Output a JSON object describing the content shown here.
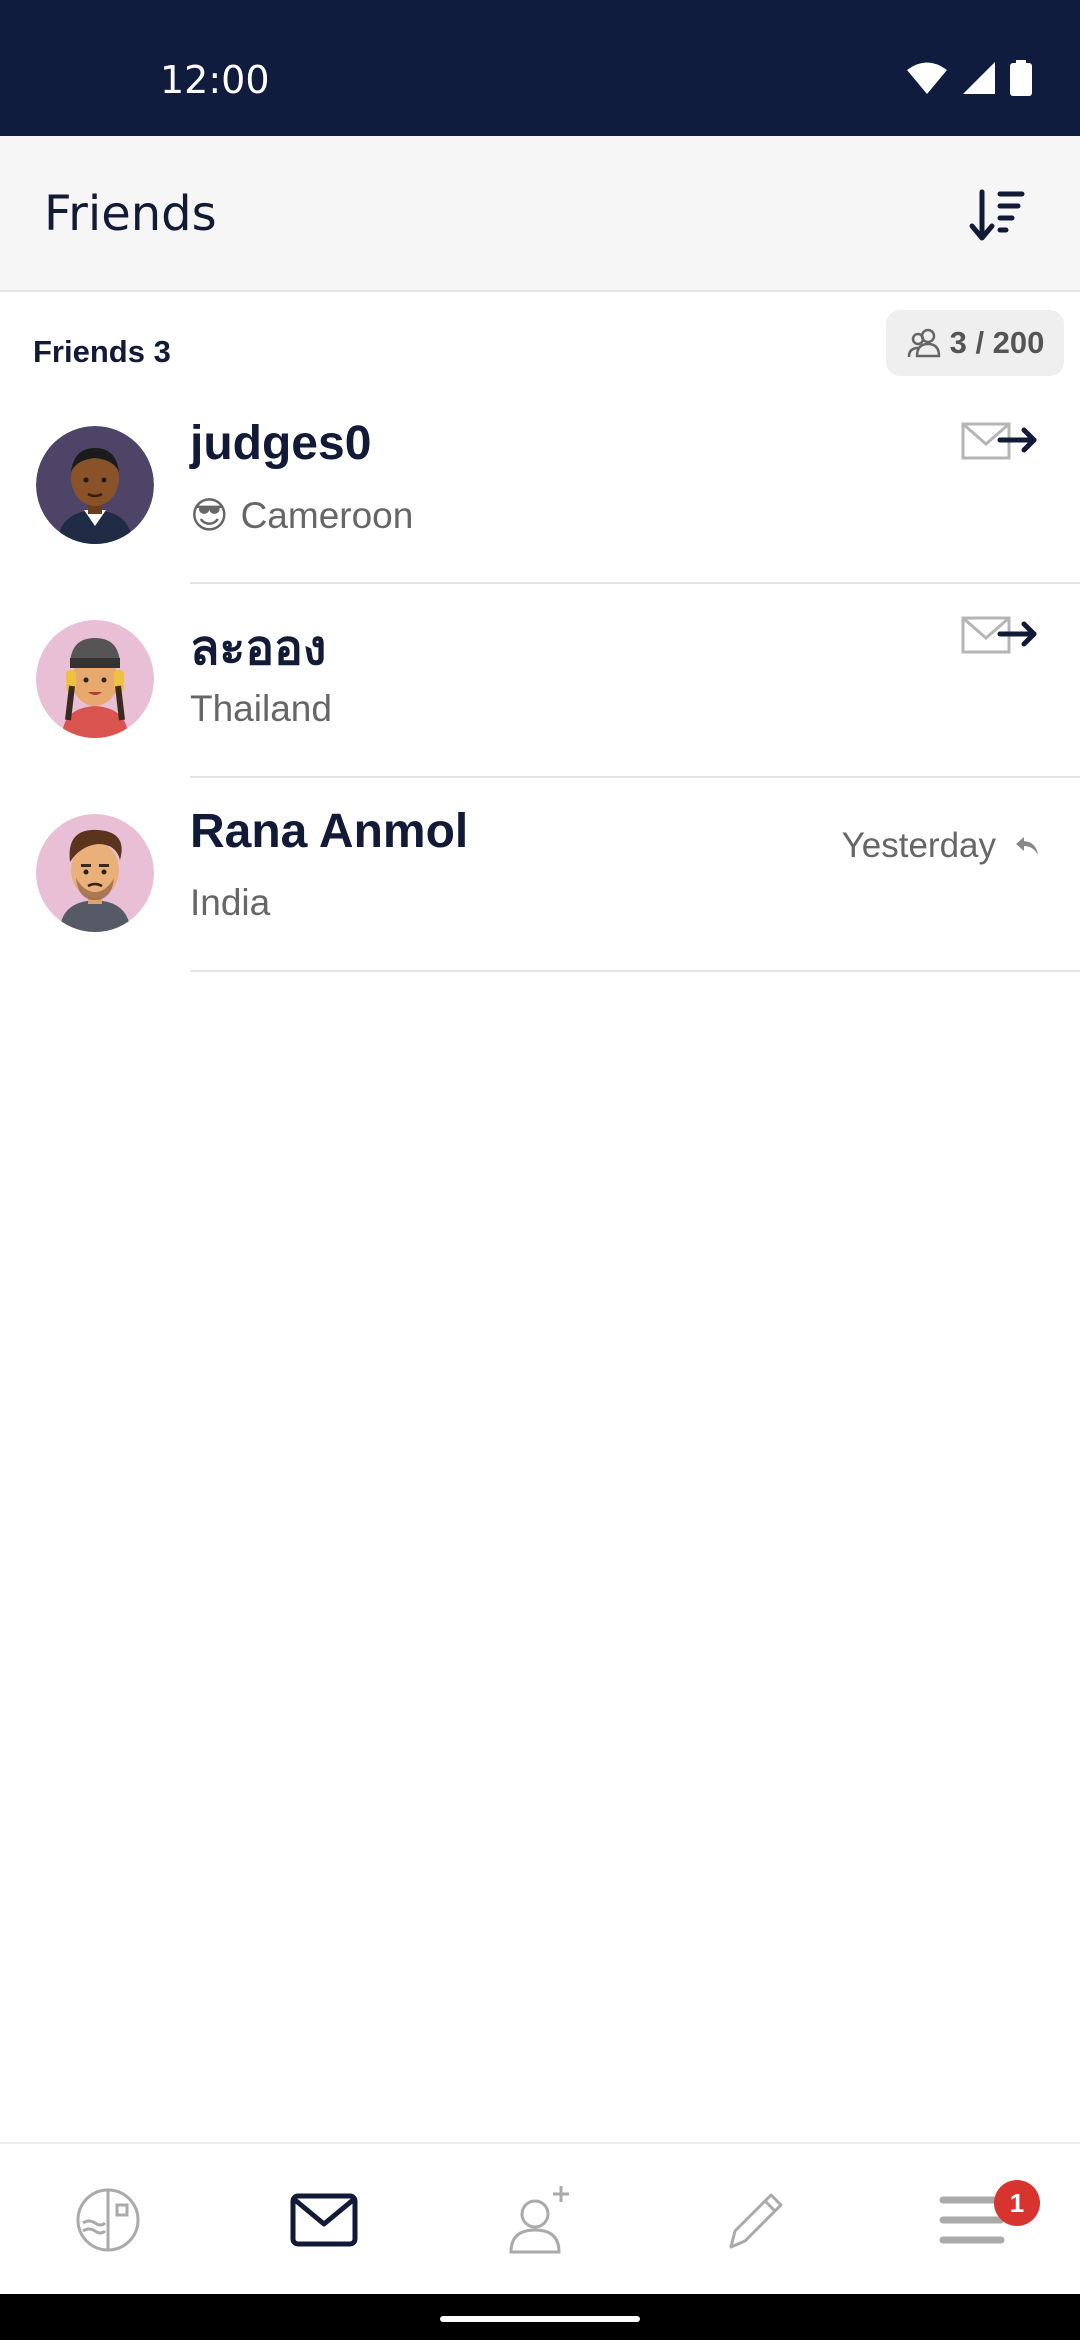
{
  "status_bar": {
    "time": "12:00"
  },
  "app_bar": {
    "title": "Friends",
    "sort_icon": "sort-descending-icon"
  },
  "section": {
    "label": "Friends 3",
    "count_badge": "3 / 200",
    "count_icon": "people-icon"
  },
  "friends": [
    {
      "name": "judges0",
      "country": "Cameroon",
      "emoji": "😎",
      "action": "send-letter-icon",
      "time": ""
    },
    {
      "name": "ละออง",
      "country": "Thailand",
      "emoji": "",
      "action": "send-letter-icon",
      "time": ""
    },
    {
      "name": "Rana Anmol",
      "country": "India",
      "emoji": "",
      "action": "",
      "time": "Yesterday",
      "time_icon": "reply-icon"
    }
  ],
  "bottom_nav": {
    "items": [
      "stamps-icon",
      "letters-icon",
      "add-friend-icon",
      "compose-icon",
      "menu-icon"
    ],
    "active": "letters-icon",
    "menu_badge": "1"
  },
  "colors": {
    "primary": "#101c3e",
    "badge": "#d8342f",
    "muted": "#666666"
  }
}
